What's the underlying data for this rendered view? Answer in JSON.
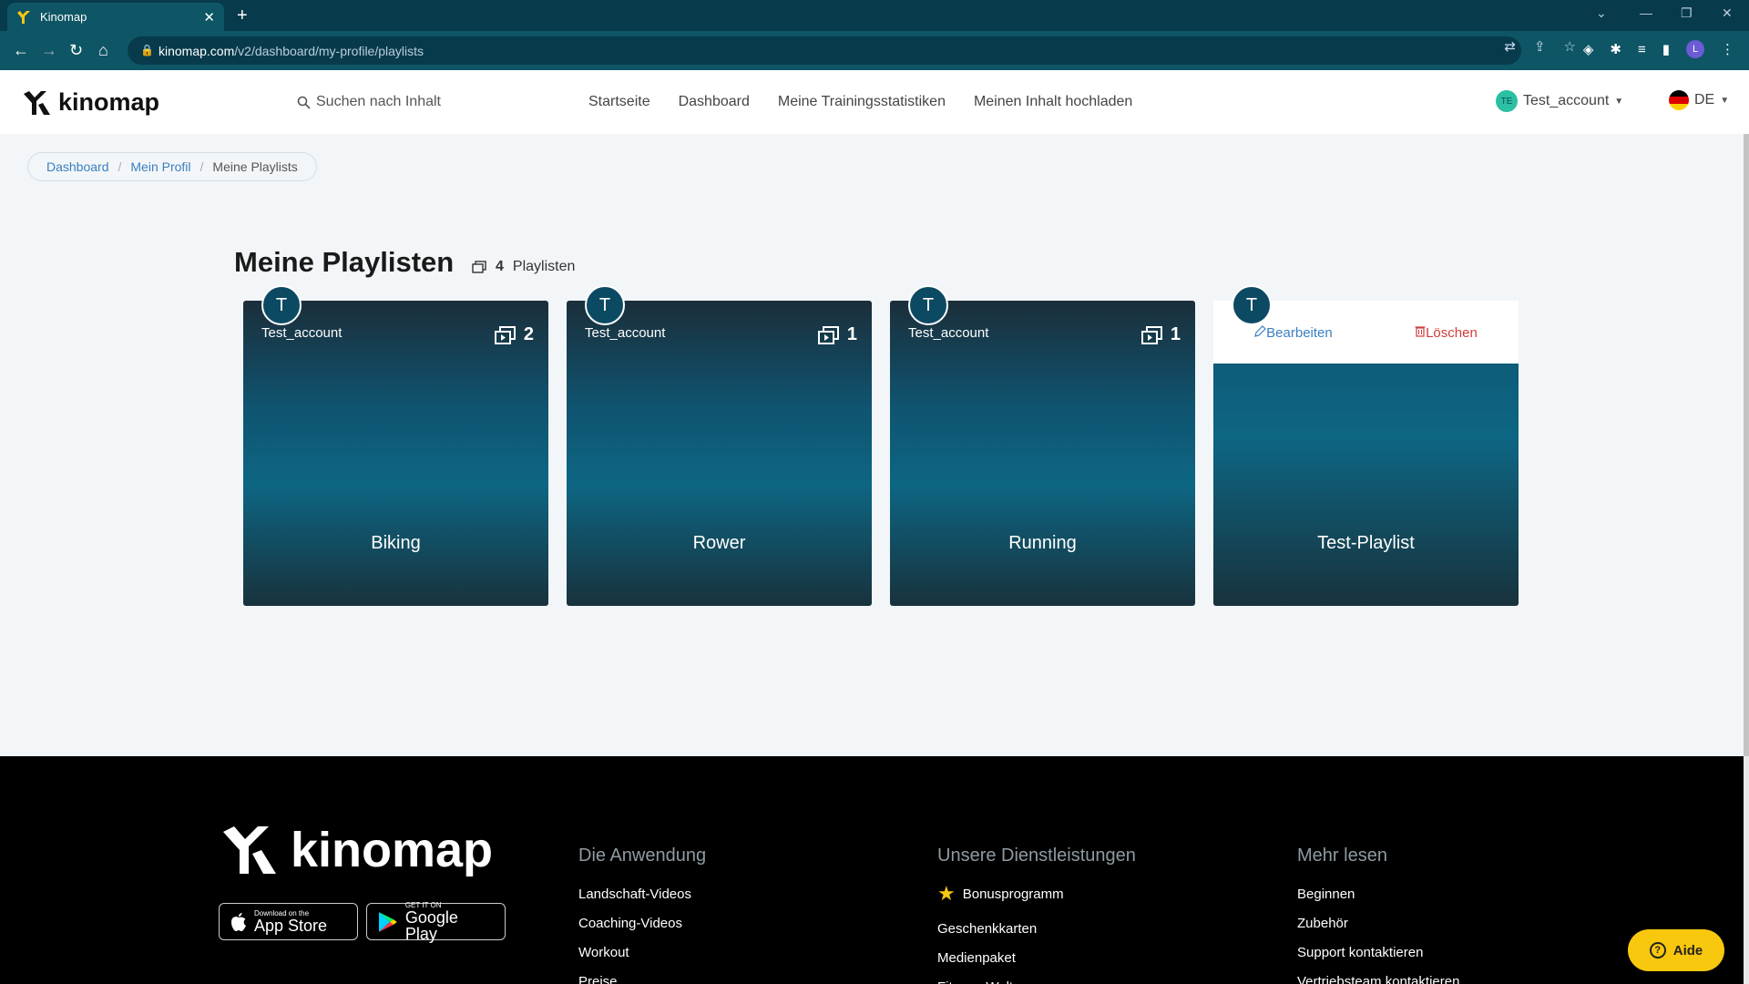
{
  "browser": {
    "tab_title": "Kinomap",
    "url_host": "kinomap.com",
    "url_path": "/v2/dashboard/my-profile/playlists",
    "profile_initial": "L"
  },
  "header": {
    "logo_text": "kinomap",
    "search_label": "Suchen nach Inhalt",
    "nav": [
      "Startseite",
      "Dashboard",
      "Meine Trainingsstatistiken",
      "Meinen Inhalt hochladen"
    ],
    "user_initials": "TE",
    "user_name": "Test_account",
    "lang": "DE"
  },
  "breadcrumb": {
    "items": [
      "Dashboard",
      "Mein Profil"
    ],
    "current": "Meine Playlists"
  },
  "page": {
    "title": "Meine Playlisten",
    "count_value": "4",
    "count_label": "Playlisten"
  },
  "playlists": [
    {
      "owner": "Test_account",
      "initial": "T",
      "videos": "2",
      "name": "Biking"
    },
    {
      "owner": "Test_account",
      "initial": "T",
      "videos": "1",
      "name": "Rower"
    },
    {
      "owner": "Test_account",
      "initial": "T",
      "videos": "1",
      "name": "Running"
    },
    {
      "owner": "",
      "initial": "T",
      "videos": "",
      "name": "Test-Playlist",
      "edit_label": "Bearbeiten",
      "delete_label": "Löschen"
    }
  ],
  "footer": {
    "logo_text": "kinomap",
    "app_store_small": "Download on the",
    "app_store_big": "App Store",
    "google_small": "GET IT ON",
    "google_big": "Google Play",
    "col1": {
      "title": "Die Anwendung",
      "items": [
        "Landschaft-Videos",
        "Coaching-Videos",
        "Workout",
        "Preise"
      ]
    },
    "col2": {
      "title": "Unsere Dienstleistungen",
      "items": [
        "Bonusprogramm",
        "Geschenkkarten",
        "Medienpaket",
        "Fitness-Welt"
      ]
    },
    "col3": {
      "title": "Mehr lesen",
      "items": [
        "Beginnen",
        "Zubehör",
        "Support kontaktieren",
        "Vertriebsteam kontaktieren"
      ]
    }
  },
  "aide_label": "Aide",
  "colors": {
    "brand_teal": "#0c4a63",
    "accent_yellow": "#f8c80e",
    "link_blue": "#3a7fc1",
    "danger_red": "#d23b3b"
  }
}
